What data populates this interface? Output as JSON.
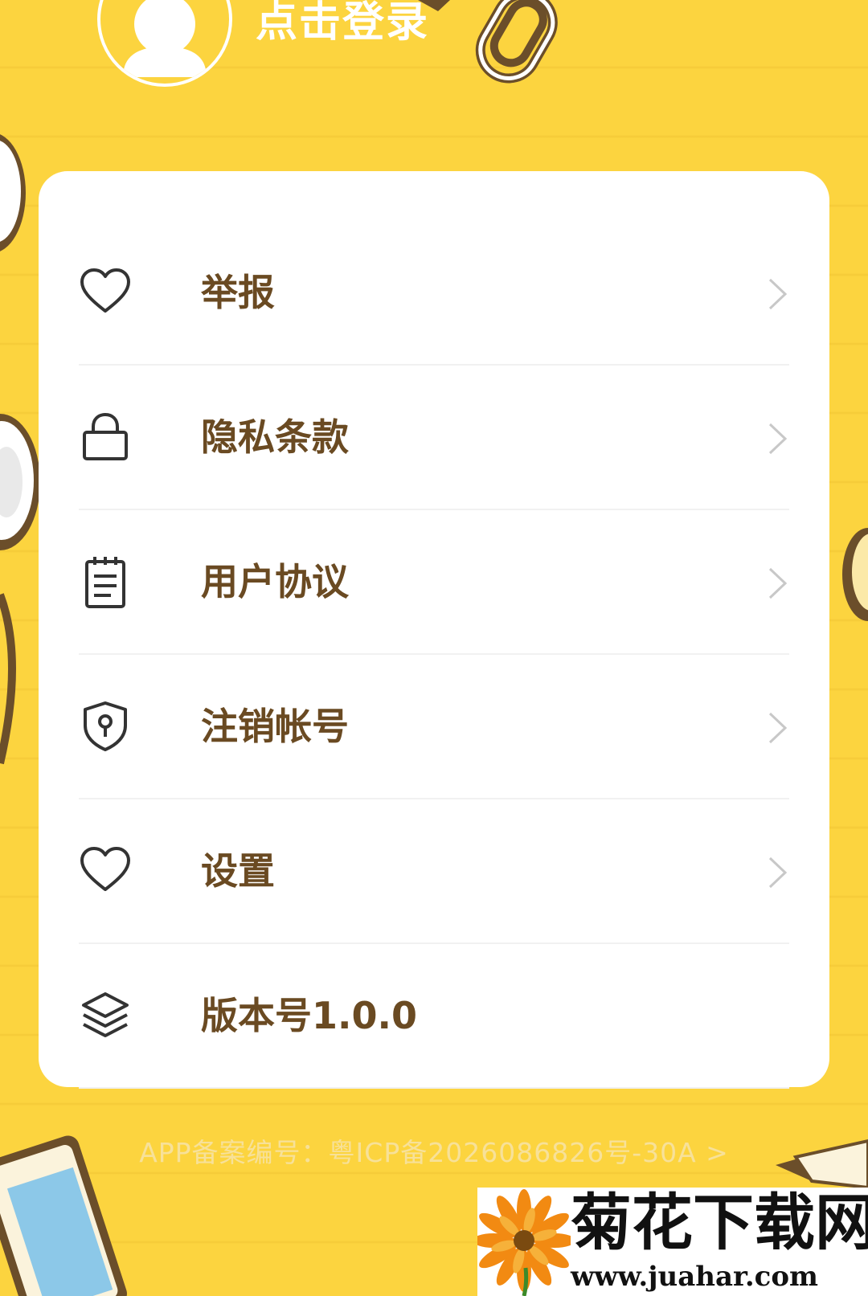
{
  "header": {
    "login_label": "点击登录"
  },
  "menu": {
    "items": [
      {
        "label": "举报",
        "icon": "heart-icon"
      },
      {
        "label": "隐私条款",
        "icon": "lock-icon"
      },
      {
        "label": "用户协议",
        "icon": "notepad-icon"
      },
      {
        "label": "注销帐号",
        "icon": "shield-keyhole-icon"
      },
      {
        "label": "设置",
        "icon": "heart-icon"
      },
      {
        "label": "版本号1.0.0",
        "icon": "layers-icon"
      }
    ]
  },
  "footer": {
    "icp_text": "APP备案编号：粤ICP备2026086826号-30A >"
  },
  "watermark": {
    "title": "菊花下载网",
    "url": "www.juahar.com"
  },
  "colors": {
    "background": "#fcd43f",
    "label_text": "#6a4a22",
    "card": "#ffffff",
    "chevron": "#c8c8c8"
  }
}
